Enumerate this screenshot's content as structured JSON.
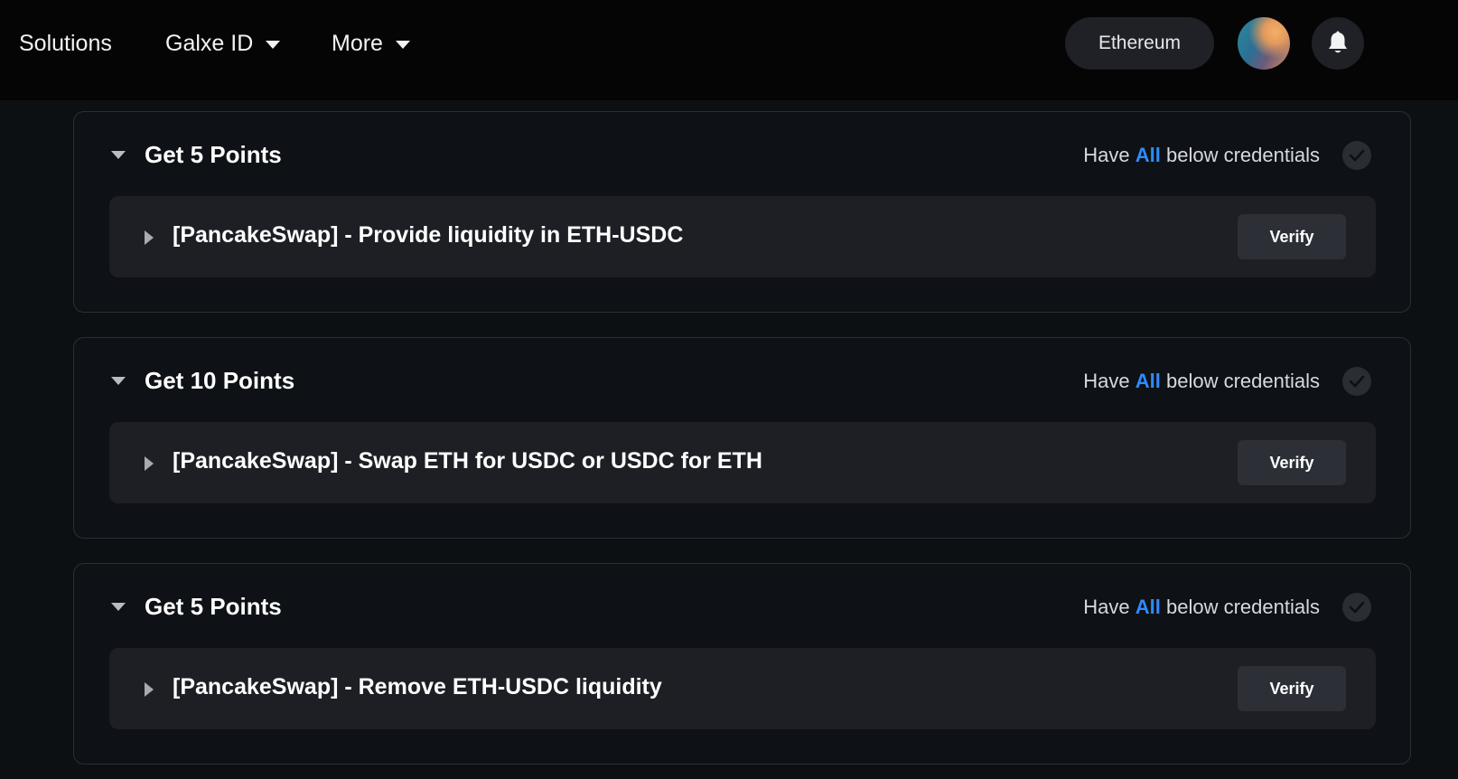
{
  "nav": {
    "solutions": "Solutions",
    "galxe_id": "Galxe ID",
    "more": "More",
    "network": "Ethereum"
  },
  "groups": [
    {
      "title": "Get 5 Points",
      "cond_prefix": "Have ",
      "cond_emph": "All",
      "cond_suffix": " below credentials",
      "credential": "[PancakeSwap] - Provide liquidity in ETH-USDC",
      "verify": "Verify"
    },
    {
      "title": "Get 10 Points",
      "cond_prefix": "Have ",
      "cond_emph": "All",
      "cond_suffix": " below credentials",
      "credential": "[PancakeSwap] - Swap ETH for USDC or USDC for ETH",
      "verify": "Verify"
    },
    {
      "title": "Get 5 Points",
      "cond_prefix": "Have ",
      "cond_emph": "All",
      "cond_suffix": " below credentials",
      "credential": "[PancakeSwap] - Remove ETH-USDC liquidity",
      "verify": "Verify"
    }
  ],
  "icons": {
    "bell": "bell-icon",
    "check": "check-icon",
    "caret_down": "caret-down-icon",
    "caret_right": "caret-right-icon"
  },
  "colors": {
    "background": "#0d1013",
    "topbar": "#050506",
    "accent": "#2f8bff",
    "card": "#1d1f24",
    "button": "#2c2f36"
  }
}
